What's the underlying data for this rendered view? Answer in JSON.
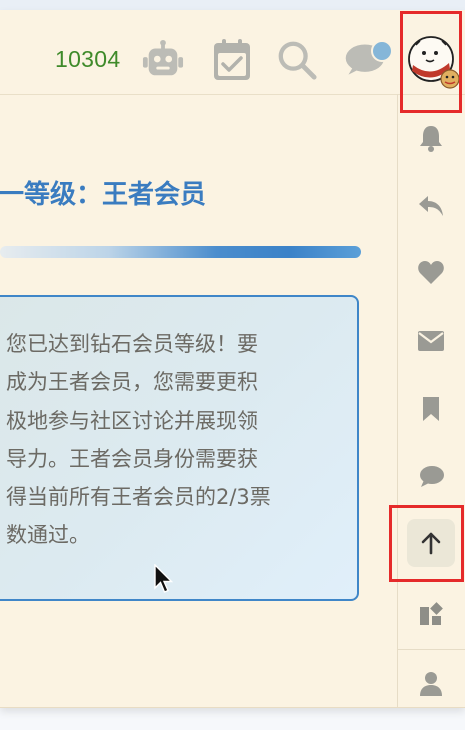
{
  "header": {
    "credits": "10304",
    "icons": [
      "robot-icon",
      "calendar-check-icon",
      "search-icon",
      "chat-bubble-icon",
      "user-avatar"
    ]
  },
  "main": {
    "level_title": "一等级：王者会员",
    "progress": {
      "fraction": 1.0
    },
    "notice_text": "您已达到钻石会员等级！要\n成为王者会员，您需要更积\n极地参与社区讨论并展现领\n导力。王者会员身份需要获\n得当前所有王者会员的2/3票\n数通过。"
  },
  "sidebar": {
    "items": [
      "bell-icon",
      "reply-icon",
      "heart-icon",
      "mail-icon",
      "bookmark-icon",
      "comment-icon",
      "arrow-up-icon",
      "widgets-icon",
      "user-icon"
    ],
    "active": "arrow-up-icon"
  },
  "colors": {
    "background": "#fbf3e2",
    "accent_blue": "#3a7cc0",
    "credits_green": "#3f8a2a",
    "icon_gray": "#9a9a94",
    "highlight_red": "#e52a2a"
  }
}
